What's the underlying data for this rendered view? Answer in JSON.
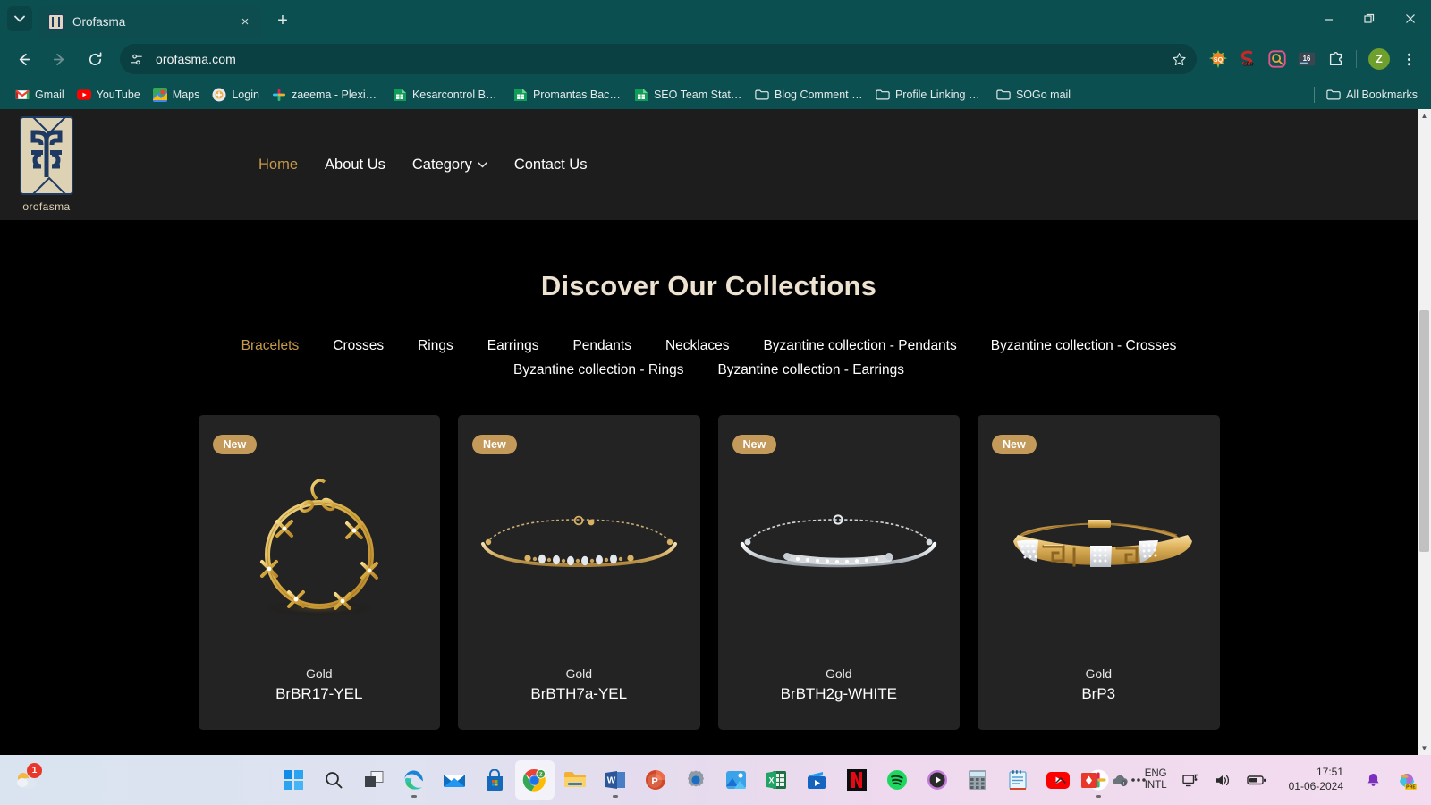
{
  "browser": {
    "tab": {
      "title": "Orofasma",
      "favicon": "orofasma-logo-icon",
      "close_label": "×"
    },
    "new_tab_label": "+",
    "tab_list_icon": "chevron-down-icon",
    "window_controls": {
      "minimize": "—",
      "maximize": "❐",
      "close": "✕"
    },
    "nav": {
      "back": "←",
      "forward": "→",
      "reload": "⟳"
    },
    "omnibox": {
      "url": "orofasma.com",
      "site_info_icon": "tune-settings-icon",
      "bookmark_icon": "star-icon"
    },
    "extensions": [
      {
        "name": "seoquake-extension",
        "label": "SQ"
      },
      {
        "name": "seo-extension",
        "label": "S"
      },
      {
        "name": "keyword-search-extension",
        "label": "Q"
      },
      {
        "name": "counter-extension",
        "label": "16"
      },
      {
        "name": "extensions-puzzle-icon",
        "label": ""
      }
    ],
    "profile": {
      "initial": "Z",
      "color": "#6f9f2c"
    },
    "menu_icon": "three-dot-menu-icon",
    "bookmarks": [
      {
        "label": "Gmail",
        "icon": "gmail-icon"
      },
      {
        "label": "YouTube",
        "icon": "youtube-icon"
      },
      {
        "label": "Maps",
        "icon": "maps-icon"
      },
      {
        "label": "Login",
        "icon": "login-icon"
      },
      {
        "label": "zaeema - Pleximus -...",
        "icon": "slack-icon"
      },
      {
        "label": "Kesarcontrol Backlin...",
        "icon": "sheets-icon"
      },
      {
        "label": "Promantas Backlinki...",
        "icon": "sheets-icon"
      },
      {
        "label": "SEO Team Status -...",
        "icon": "sheets-icon"
      },
      {
        "label": "Blog Comment Lin...",
        "icon": "folder-icon"
      },
      {
        "label": "Profile Linking and...",
        "icon": "folder-icon"
      },
      {
        "label": "SOGo mail",
        "icon": "folder-icon"
      }
    ],
    "all_bookmarks": {
      "label": "All Bookmarks",
      "icon": "folder-icon"
    }
  },
  "site": {
    "logo": {
      "word": "orofasma",
      "mark": "orofasma-monogram-icon"
    },
    "nav": [
      {
        "label": "Home",
        "active": true,
        "has_caret": false
      },
      {
        "label": "About Us",
        "active": false,
        "has_caret": false
      },
      {
        "label": "Category",
        "active": false,
        "has_caret": true
      },
      {
        "label": "Contact Us",
        "active": false,
        "has_caret": false
      }
    ],
    "heading": "Discover Our Collections",
    "categories": [
      {
        "label": "Bracelets",
        "active": true
      },
      {
        "label": "Crosses",
        "active": false
      },
      {
        "label": "Rings",
        "active": false
      },
      {
        "label": "Earrings",
        "active": false
      },
      {
        "label": "Pendants",
        "active": false
      },
      {
        "label": "Necklaces",
        "active": false
      },
      {
        "label": "Byzantine collection - Pendants",
        "active": false
      },
      {
        "label": "Byzantine collection - Crosses",
        "active": false
      },
      {
        "label": "Byzantine collection - Rings",
        "active": false
      },
      {
        "label": "Byzantine collection - Earrings",
        "active": false
      }
    ],
    "products": [
      {
        "badge": "New",
        "material": "Gold",
        "sku": "BrBR17-YEL",
        "image": "gold-star-link-bracelet"
      },
      {
        "badge": "New",
        "material": "Gold",
        "sku": "BrBTH7a-YEL",
        "image": "gold-chain-bangle-bracelet"
      },
      {
        "badge": "New",
        "material": "Gold",
        "sku": "BrBTH2g-WHITE",
        "image": "white-gold-chain-bangle-bracelet"
      },
      {
        "badge": "New",
        "material": "Gold",
        "sku": "BrP3",
        "image": "greek-key-diamond-bracelet"
      }
    ],
    "colors": {
      "accent_gold": "#c79a4b",
      "badge_gold": "#c49a5a",
      "header_bg": "#1d1d1d",
      "card_bg": "#232323",
      "page_bg": "#000000",
      "heading": "#ece2cf"
    }
  },
  "taskbar": {
    "weather": {
      "badge": "1",
      "icon": "weather-icon"
    },
    "apps": [
      {
        "name": "start-button",
        "icon": "windows-logo-icon",
        "state": ""
      },
      {
        "name": "search-button",
        "icon": "search-icon",
        "state": ""
      },
      {
        "name": "task-view-button",
        "icon": "task-view-icon",
        "state": ""
      },
      {
        "name": "edge",
        "icon": "edge-icon",
        "state": "running"
      },
      {
        "name": "mail",
        "icon": "mail-icon",
        "state": ""
      },
      {
        "name": "microsoft-store",
        "icon": "store-icon",
        "state": ""
      },
      {
        "name": "chrome",
        "icon": "chrome-icon",
        "state": "active",
        "overlay": "Z"
      },
      {
        "name": "file-explorer",
        "icon": "folder-icon",
        "state": ""
      },
      {
        "name": "word",
        "icon": "word-icon",
        "state": "running"
      },
      {
        "name": "powerpoint",
        "icon": "powerpoint-icon",
        "state": ""
      },
      {
        "name": "settings",
        "icon": "gear-icon",
        "state": ""
      },
      {
        "name": "photos",
        "icon": "photos-icon",
        "state": ""
      },
      {
        "name": "excel",
        "icon": "excel-icon",
        "state": ""
      },
      {
        "name": "movies-tv",
        "icon": "movies-tv-icon",
        "state": ""
      },
      {
        "name": "netflix",
        "icon": "netflix-icon",
        "state": ""
      },
      {
        "name": "spotify",
        "icon": "spotify-icon",
        "state": ""
      },
      {
        "name": "media-player",
        "icon": "media-player-icon",
        "state": ""
      },
      {
        "name": "calculator",
        "icon": "calculator-icon",
        "state": ""
      },
      {
        "name": "notepad",
        "icon": "notepad-icon",
        "state": ""
      },
      {
        "name": "youtube",
        "icon": "youtube-icon",
        "state": ""
      },
      {
        "name": "slack",
        "icon": "slack-icon",
        "state": "running"
      },
      {
        "name": "taskbar-overflow",
        "icon": "three-dot-menu-icon",
        "state": ""
      }
    ],
    "tray": {
      "overflow_icon": "chevron-up-icon",
      "items": [
        {
          "name": "antivirus-tray-icon",
          "label": ""
        },
        {
          "name": "onedrive-tray-icon",
          "label": ""
        }
      ],
      "language": {
        "line1": "ENG",
        "line2": "INTL"
      },
      "network_icon": "network-icon",
      "volume_icon": "volume-icon",
      "battery_icon": "battery-icon",
      "clock": {
        "time": "17:51",
        "date": "01-06-2024"
      },
      "notifications_icon": "bell-icon",
      "copilot": {
        "icon": "copilot-icon",
        "label": "PRE"
      }
    }
  },
  "scrollbar": {
    "up_arrow": "▲",
    "down_arrow": "▼"
  }
}
